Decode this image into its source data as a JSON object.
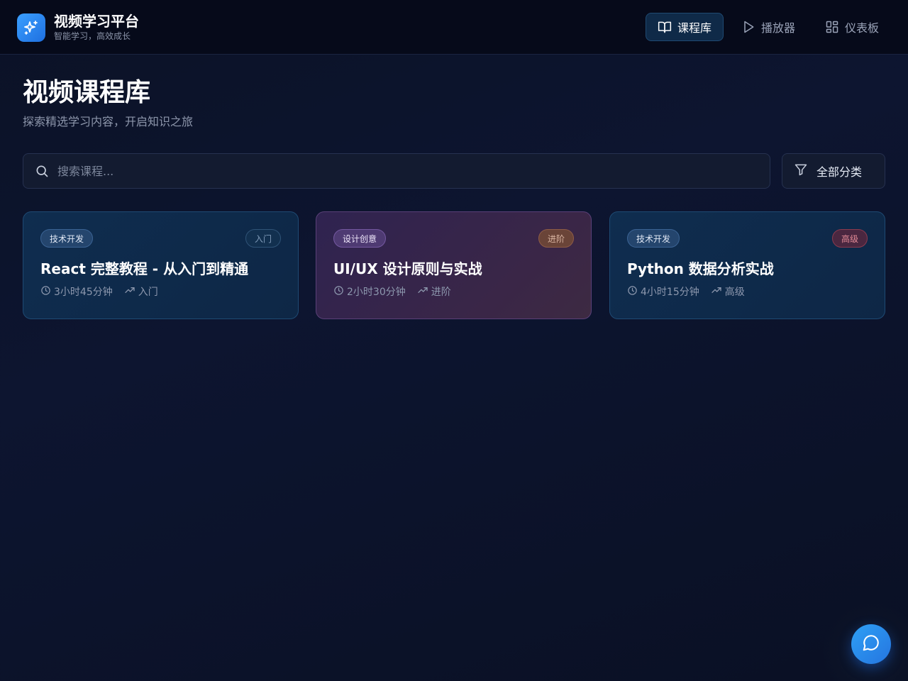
{
  "header": {
    "brand_title": "视频学习平台",
    "brand_subtitle": "智能学习，高效成长",
    "nav": [
      {
        "label": "课程库",
        "icon": "book-open-icon",
        "active": true
      },
      {
        "label": "播放器",
        "icon": "play-icon",
        "active": false
      },
      {
        "label": "仪表板",
        "icon": "dashboard-grid-icon",
        "active": false
      }
    ]
  },
  "page": {
    "title": "视频课程库",
    "subtitle": "探索精选学习内容，开启知识之旅"
  },
  "search": {
    "placeholder": "搜索课程...",
    "value": ""
  },
  "filter": {
    "label": "全部分类"
  },
  "courses": [
    {
      "category": "技术开发",
      "level": "入门",
      "title": "React 完整教程 - 从入门到精通",
      "duration": "3小时45分钟",
      "level_meta": "入门"
    },
    {
      "category": "设计创意",
      "level": "进阶",
      "title": "UI/UX 设计原则与实战",
      "duration": "2小时30分钟",
      "level_meta": "进阶"
    },
    {
      "category": "技术开发",
      "level": "高级",
      "title": "Python 数据分析实战",
      "duration": "4小时15分钟",
      "level_meta": "高级"
    }
  ],
  "colors": {
    "accent": "#2ea0f5",
    "background": "#0b1226",
    "card_blue": "#0f2d4f",
    "card_purple": "#2f2350"
  }
}
